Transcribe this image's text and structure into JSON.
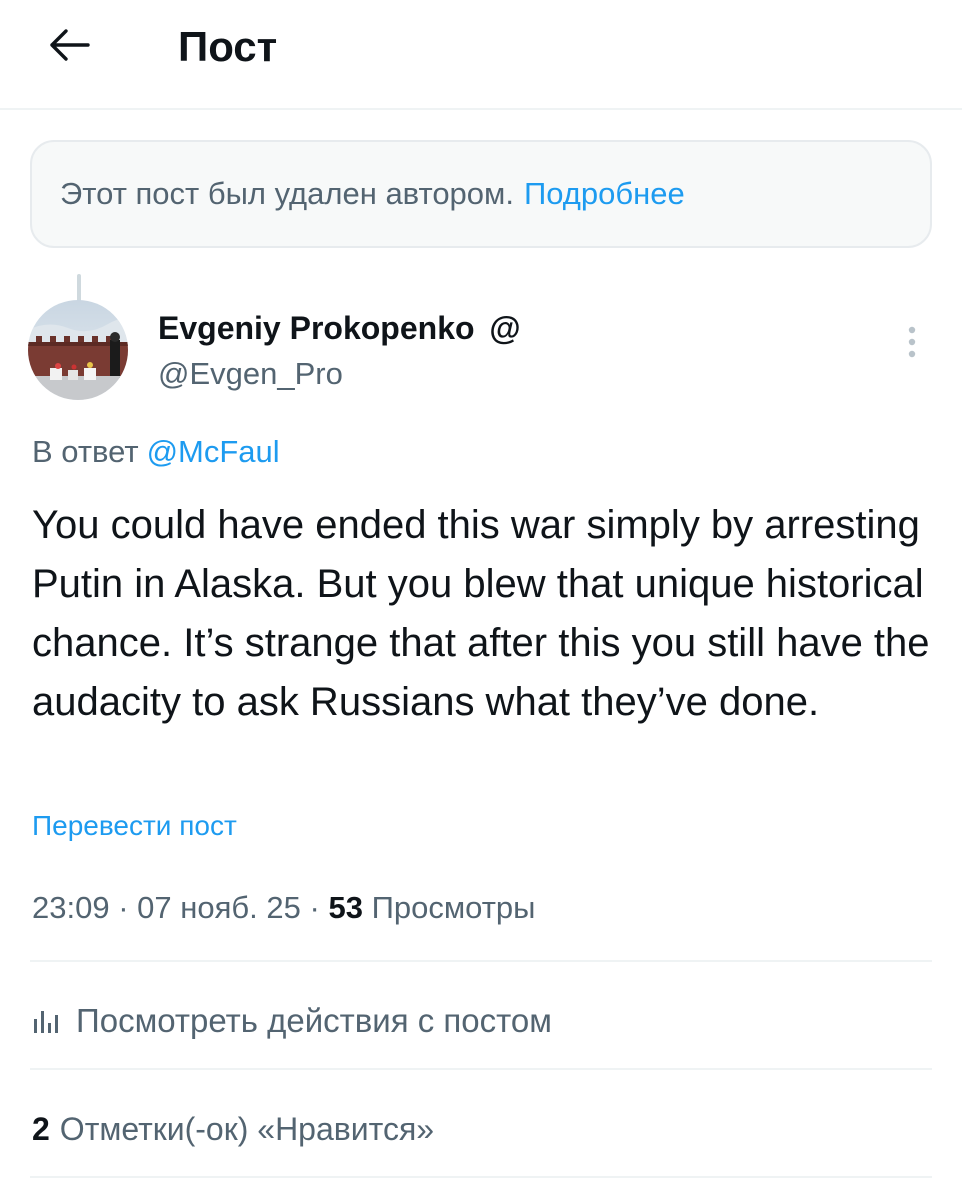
{
  "header": {
    "title": "Пост",
    "back_icon": "arrow-left-icon"
  },
  "notice": {
    "text": "Этот пост был удален автором.",
    "link": "Подробнее"
  },
  "author": {
    "name": "Evgeniy Prokopenko",
    "badge": "@",
    "handle": "@Evgen_Pro",
    "more_icon": "more-vertical-icon"
  },
  "reply": {
    "prefix": "В ответ",
    "mention": "@McFaul"
  },
  "post": {
    "text": "You could have ended this war simply by arresting Putin in Alaska. But you blew that unique historical chance. It’s strange that after this you still have the audacity to ask Russians what they’ve done.",
    "translate": "Перевести пост",
    "time": "23:09",
    "date": "07 нояб. 25",
    "separator": "·",
    "views_count": "53",
    "views_label": "Просмотры"
  },
  "analytics": {
    "label": "Посмотреть действия с постом",
    "icon": "bar-chart-icon"
  },
  "likes": {
    "count": "2",
    "label": "Отметки(-ок) «Нравится»"
  },
  "colors": {
    "accent": "#1d9bf0",
    "text": "#0f1419",
    "secondary": "#536471",
    "border": "#eff3f4"
  }
}
